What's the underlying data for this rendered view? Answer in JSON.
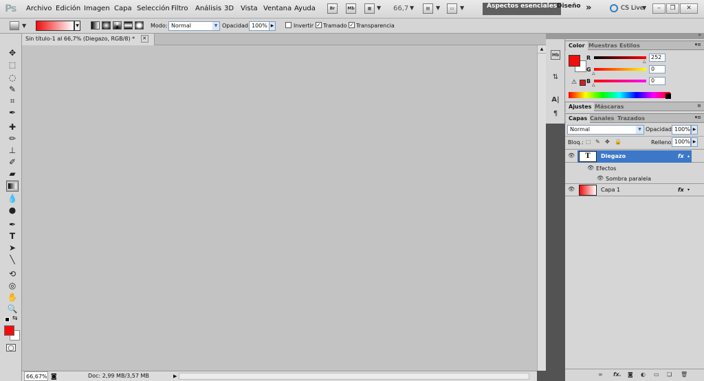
{
  "app": {
    "logo": "Ps"
  },
  "menu": [
    "Archivo",
    "Edición",
    "Imagen",
    "Capa",
    "Selección",
    "Filtro",
    "Análisis",
    "3D",
    "Vista",
    "Ventana",
    "Ayuda"
  ],
  "menubar": {
    "bridge": "Br",
    "mini_bridge": "Mb",
    "zoom": "66,7",
    "workspace_active": "Aspectos esenciales",
    "workspace_2": "Diseño",
    "more": "»",
    "cslive": "CS Live",
    "dropdown_arrow": "▼"
  },
  "options": {
    "mode_label": "Modo:",
    "mode_value": "Normal",
    "opacity_label": "Opacidad:",
    "opacity_value": "100%",
    "invert_label": "Invertir",
    "invert_checked": "",
    "dither_label": "Tramado",
    "dither_checked": "✓",
    "transparency_label": "Transparencia",
    "transparency_checked": "✓"
  },
  "document": {
    "tab_title": "Sin título-1 al 66,7% (Diegazo, RGB/8) *",
    "tab_close": "✕",
    "status_zoom": "66,67%",
    "status_doc": "Doc: 2,99 MB/3,57 MB"
  },
  "color_panel": {
    "tabs": [
      "Color",
      "Muestras",
      "Estilos"
    ],
    "r_label": "R",
    "r_value": "252",
    "g_label": "G",
    "g_value": "0",
    "b_label": "B",
    "b_value": "0"
  },
  "adjust_panel": {
    "tabs": [
      "Ajustes",
      "Máscaras"
    ]
  },
  "layers_panel": {
    "tabs": [
      "Capas",
      "Canales",
      "Trazados"
    ],
    "blend_mode": "Normal",
    "opacity_label": "Opacidad:",
    "opacity_value": "100%",
    "lock_label": "Bloq.:",
    "fill_label": "Relleno:",
    "fill_value": "100%",
    "fx": "fx",
    "layers": [
      {
        "name": "Diegazo",
        "thumb": "T"
      },
      {
        "name": "Efectos"
      },
      {
        "name": "Sombra paralela"
      },
      {
        "name": "Capa 1"
      }
    ]
  },
  "colors": {
    "foreground": "#f10d0d",
    "background": "#ffffff",
    "selected_layer": "#3d78c8"
  }
}
